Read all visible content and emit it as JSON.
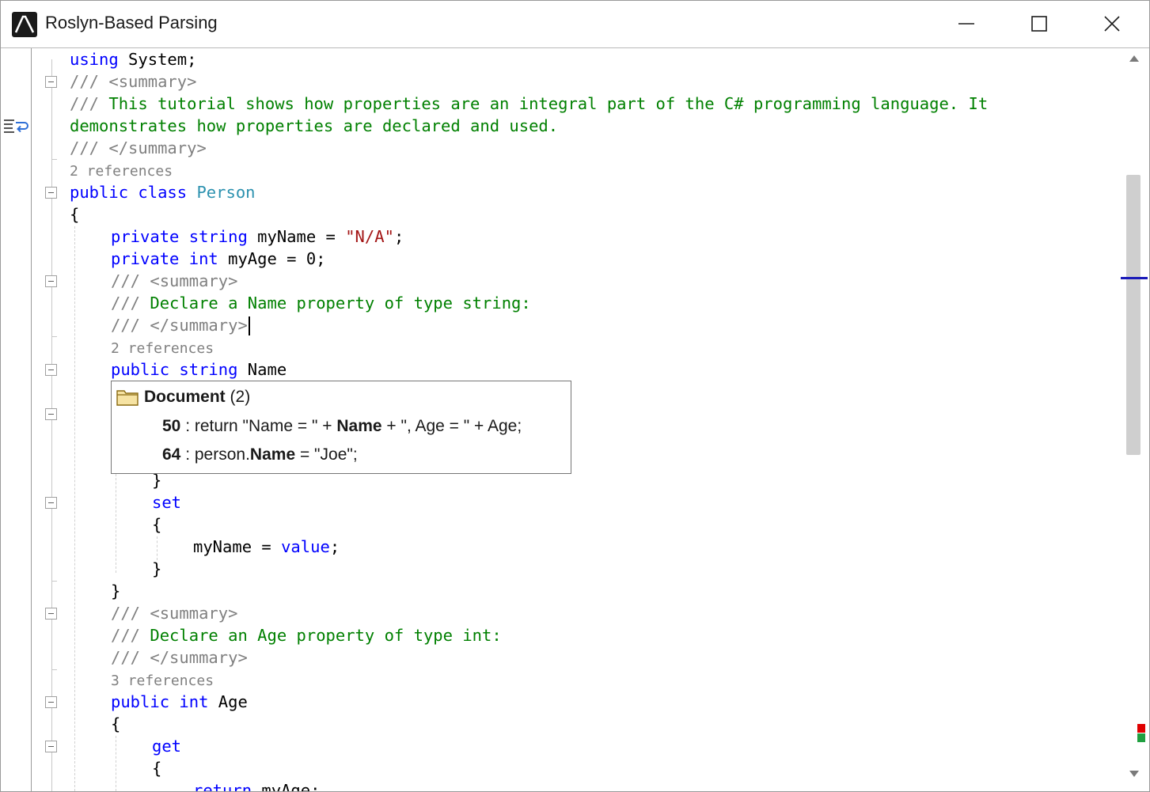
{
  "window": {
    "title": "Roslyn-Based Parsing"
  },
  "code": {
    "lines": [
      [
        {
          "c": "kw",
          "t": "using"
        },
        {
          "c": "",
          "t": " System;"
        }
      ],
      [
        {
          "c": "cg",
          "t": "/// <summary>"
        }
      ],
      [
        {
          "c": "cg",
          "t": "/// "
        },
        {
          "c": "cm",
          "t": "This tutorial shows how properties are an integral part of the C# programming language. It"
        }
      ],
      [
        {
          "c": "cm",
          "t": "demonstrates how properties are declared and used."
        }
      ],
      [
        {
          "c": "cg",
          "t": "/// </summary>"
        }
      ],
      [
        {
          "c": "ref",
          "t": "2 references"
        }
      ],
      [
        {
          "c": "kw",
          "t": "public class"
        },
        {
          "c": "",
          "t": " "
        },
        {
          "c": "ty",
          "t": "Person"
        }
      ],
      [
        {
          "c": "",
          "t": "{"
        }
      ],
      [
        {
          "c": "kw",
          "t": "private string"
        },
        {
          "c": "",
          "t": " myName = "
        },
        {
          "c": "st",
          "t": "\"N/A\""
        },
        {
          "c": "",
          "t": ";"
        }
      ],
      [
        {
          "c": "kw",
          "t": "private int"
        },
        {
          "c": "",
          "t": " myAge = 0;"
        }
      ],
      [
        {
          "c": "cg",
          "t": "/// <summary>"
        }
      ],
      [
        {
          "c": "cg",
          "t": "/// "
        },
        {
          "c": "cm",
          "t": "Declare a Name property of type string:"
        }
      ],
      [
        {
          "c": "cg",
          "t": "/// </summary>"
        }
      ],
      [
        {
          "c": "ref",
          "t": "2 references"
        }
      ],
      [
        {
          "c": "kw",
          "t": "public string"
        },
        {
          "c": "",
          "t": " Name"
        }
      ],
      [
        {
          "c": "",
          "t": "}"
        }
      ],
      [
        {
          "c": "kw",
          "t": "set"
        }
      ],
      [
        {
          "c": "",
          "t": "{"
        }
      ],
      [
        {
          "c": "",
          "t": "myName = "
        },
        {
          "c": "kw",
          "t": "value"
        },
        {
          "c": "",
          "t": ";"
        }
      ],
      [
        {
          "c": "",
          "t": "}"
        }
      ],
      [
        {
          "c": "",
          "t": "}"
        }
      ],
      [
        {
          "c": "cg",
          "t": "/// <summary>"
        }
      ],
      [
        {
          "c": "cg",
          "t": "/// "
        },
        {
          "c": "cm",
          "t": "Declare an Age property of type int:"
        }
      ],
      [
        {
          "c": "cg",
          "t": "/// </summary>"
        }
      ],
      [
        {
          "c": "ref",
          "t": "3 references"
        }
      ],
      [
        {
          "c": "kw",
          "t": "public int"
        },
        {
          "c": "",
          "t": " Age"
        }
      ],
      [
        {
          "c": "",
          "t": "{"
        }
      ],
      [
        {
          "c": "kw",
          "t": "get"
        }
      ],
      [
        {
          "c": "",
          "t": "{"
        }
      ],
      [
        {
          "c": "kw",
          "t": "return"
        },
        {
          "c": "",
          "t": " myAge;"
        }
      ]
    ]
  },
  "popup": {
    "title": "Document",
    "count": "(2)",
    "items": [
      {
        "line": "50",
        "parts": [
          {
            "b": false,
            "t": " : return \"Name = \" + "
          },
          {
            "b": true,
            "t": "Name"
          },
          {
            "b": false,
            "t": " + \", Age = \" + Age;"
          }
        ]
      },
      {
        "line": "64",
        "parts": [
          {
            "b": false,
            "t": " : person."
          },
          {
            "b": true,
            "t": "Name"
          },
          {
            "b": false,
            "t": " = \"Joe\";"
          }
        ]
      }
    ]
  },
  "icons": {
    "app": "app-logo-icon",
    "minimize": "minimize-icon",
    "maximize": "maximize-icon",
    "close": "close-icon",
    "word_wrap": "word-wrap-icon",
    "folder": "folder-icon",
    "scroll_up": "scroll-up-icon",
    "scroll_down": "scroll-down-icon"
  },
  "colors": {
    "keyword": "#0000ff",
    "type": "#2b91af",
    "comment": "#008000",
    "doc_tag": "#808080",
    "string": "#a31515",
    "scroll_position": "#1a1ab8",
    "error_marker": "#e00000",
    "change_marker": "#20a040"
  }
}
